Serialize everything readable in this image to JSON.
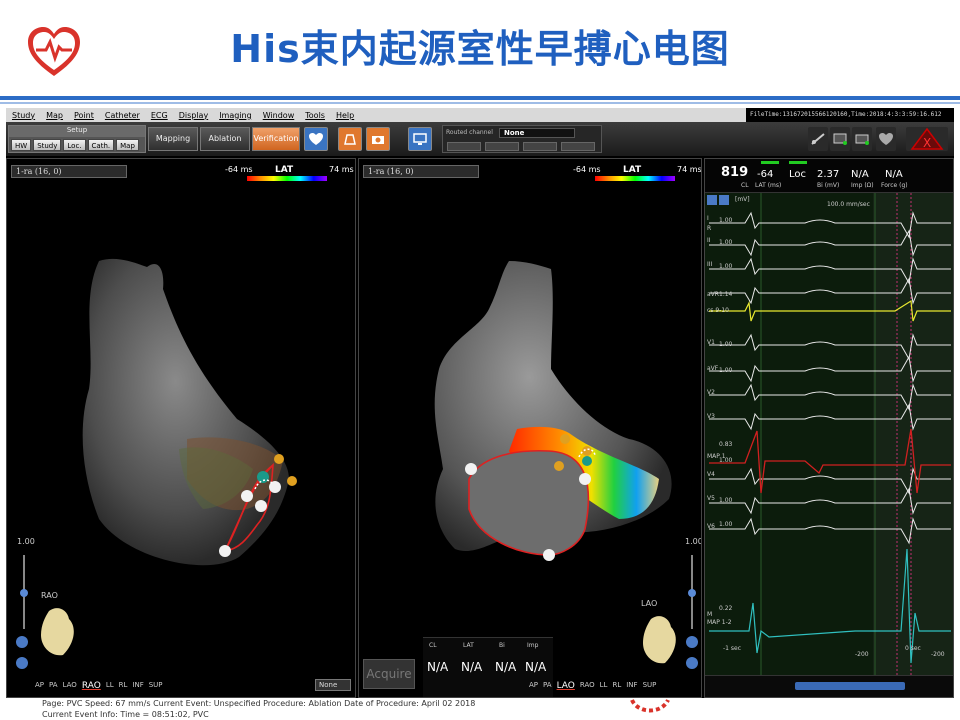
{
  "slide": {
    "title": "His束内起源室性早搏心电图"
  },
  "menu": [
    "Study",
    "Map",
    "Point",
    "Catheter",
    "ECG",
    "Display",
    "Imaging",
    "Window",
    "Tools",
    "Help"
  ],
  "file_time": "FileTime:1316720155661201​60,Time:2018:4:3:3:59:16.612",
  "toolbar": {
    "setup_label": "Setup",
    "setup_buttons": [
      "HW",
      "Study",
      "Loc.",
      "Cath.",
      "Map"
    ],
    "mapping": "Mapping",
    "ablation": "Ablation",
    "verification": "Verification",
    "routed_label": "Routed channel",
    "routed_value": "None"
  },
  "left_map": {
    "map_select": "1-ra (16, 0)",
    "lat_min": "-64 ms",
    "lat_title": "LAT",
    "lat_max": "74 ms",
    "slider_value": "1.00",
    "orientation": "RAO",
    "views": [
      "AP",
      "PA",
      "LAO",
      "RAO",
      "LL",
      "RL",
      "INF",
      "SUP"
    ],
    "selected_view": "RAO",
    "dropdown": "None"
  },
  "right_map": {
    "map_select": "1-ra (16, 0)",
    "lat_min": "-64 ms",
    "lat_title": "LAT",
    "lat_max": "74 ms",
    "slider_value": "1.00",
    "orientation": "LAO",
    "views": [
      "AP",
      "PA",
      "LAO",
      "RAO",
      "LL",
      "RL",
      "INF",
      "SUP"
    ],
    "selected_view": "LAO",
    "acquire": "Acquire",
    "cl_headers": [
      "CL",
      "LAT",
      "Bi",
      "Imp"
    ],
    "cl_values": [
      "N/A",
      "N/A",
      "N/A",
      "N/A"
    ]
  },
  "ecg": {
    "cl_value": "819",
    "cl_label": "CL",
    "lat_value": "-64",
    "lat_label": "LAT (ms)",
    "loc": "Loc",
    "bi_value": "2.37",
    "bi_label": "Bi (mV)",
    "imp_value": "N/A",
    "imp_label": "Imp (Ω)",
    "force_value": "N/A",
    "force_label": "Force (g)",
    "unit": "[mV]",
    "speed": "100.0 mm/sec",
    "leads": [
      "I",
      "R",
      "II",
      "III",
      "aVR",
      "cs 9-10",
      "V1",
      "aVF",
      "V2",
      "V3",
      "MAP 1",
      "V4",
      "V5",
      "V6",
      "M",
      "MAP 1-2"
    ],
    "gains": [
      "1.00",
      "1.00",
      "1.00",
      "1.14",
      "1.00",
      "1.00",
      "0.83",
      "1.00",
      "1.00",
      "1.00",
      "0.22"
    ],
    "time_labels": [
      "-1 sec",
      "-200",
      "-200",
      "0 sec"
    ]
  },
  "procedure_info": {
    "line1": "Page: PVC   Speed: 67 mm/s      Current Event: Unspecified      Procedure: Ablation    Date of Procedure: April 02 2018",
    "line2": "Current Event Info: Time = 08:51:02,  PVC"
  },
  "colors": {
    "title_blue": "#1f5fbf",
    "accent_orange": "#e0782e",
    "logo_red": "#d9332b"
  }
}
